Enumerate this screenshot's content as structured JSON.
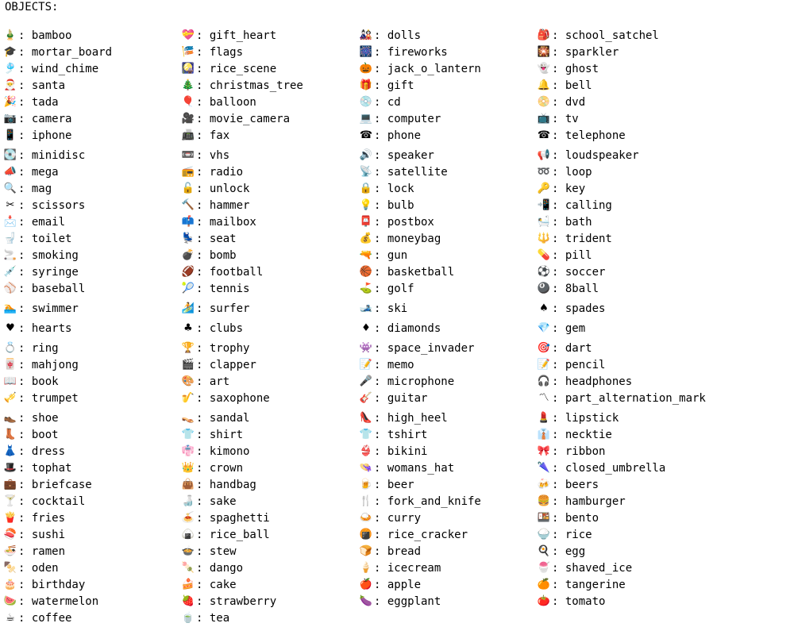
{
  "heading": "OBJECTS:",
  "rows": [
    {
      "tall": false,
      "items": [
        {
          "name": "bamboo",
          "icon": "bamboo-icon",
          "glyph": "🎍"
        },
        {
          "name": "gift_heart",
          "icon": "gift-heart-icon",
          "glyph": "💝"
        },
        {
          "name": "dolls",
          "icon": "dolls-icon",
          "glyph": "🎎"
        },
        {
          "name": "school_satchel",
          "icon": "school-satchel-icon",
          "glyph": "🎒"
        }
      ]
    },
    {
      "tall": false,
      "items": [
        {
          "name": "mortar_board",
          "icon": "mortar-board-icon",
          "glyph": "🎓"
        },
        {
          "name": "flags",
          "icon": "flags-icon",
          "glyph": "🎏"
        },
        {
          "name": "fireworks",
          "icon": "fireworks-icon",
          "glyph": "🎆"
        },
        {
          "name": "sparkler",
          "icon": "sparkler-icon",
          "glyph": "🎇"
        }
      ]
    },
    {
      "tall": false,
      "items": [
        {
          "name": "wind_chime",
          "icon": "wind-chime-icon",
          "glyph": "🎐"
        },
        {
          "name": "rice_scene",
          "icon": "rice-scene-icon",
          "glyph": "🎑"
        },
        {
          "name": "jack_o_lantern",
          "icon": "jack-o-lantern-icon",
          "glyph": "🎃"
        },
        {
          "name": "ghost",
          "icon": "ghost-icon",
          "glyph": "👻"
        }
      ]
    },
    {
      "tall": false,
      "items": [
        {
          "name": "santa",
          "icon": "santa-icon",
          "glyph": "🎅"
        },
        {
          "name": "christmas_tree",
          "icon": "christmas-tree-icon",
          "glyph": "🎄"
        },
        {
          "name": "gift",
          "icon": "gift-icon",
          "glyph": "🎁"
        },
        {
          "name": "bell",
          "icon": "bell-icon",
          "glyph": "🔔"
        }
      ]
    },
    {
      "tall": false,
      "items": [
        {
          "name": "tada",
          "icon": "tada-icon",
          "glyph": "🎉"
        },
        {
          "name": "balloon",
          "icon": "balloon-icon",
          "glyph": "🎈"
        },
        {
          "name": "cd",
          "icon": "cd-icon",
          "glyph": "💿"
        },
        {
          "name": "dvd",
          "icon": "dvd-icon",
          "glyph": "📀"
        }
      ]
    },
    {
      "tall": false,
      "items": [
        {
          "name": "camera",
          "icon": "camera-icon",
          "glyph": "📷"
        },
        {
          "name": "movie_camera",
          "icon": "movie-camera-icon",
          "glyph": "🎥"
        },
        {
          "name": "computer",
          "icon": "computer-icon",
          "glyph": "💻"
        },
        {
          "name": "tv",
          "icon": "tv-icon",
          "glyph": "📺"
        }
      ]
    },
    {
      "tall": true,
      "items": [
        {
          "name": "iphone",
          "icon": "iphone-icon",
          "glyph": "📱"
        },
        {
          "name": "fax",
          "icon": "fax-icon",
          "glyph": "📠"
        },
        {
          "name": "phone",
          "icon": "phone-icon",
          "glyph": "☎"
        },
        {
          "name": "telephone",
          "icon": "telephone-icon",
          "glyph": "☎"
        }
      ]
    },
    {
      "tall": false,
      "items": [
        {
          "name": "minidisc",
          "icon": "minidisc-icon",
          "glyph": "💽"
        },
        {
          "name": "vhs",
          "icon": "vhs-icon",
          "glyph": "📼"
        },
        {
          "name": "speaker",
          "icon": "speaker-icon",
          "glyph": "🔊"
        },
        {
          "name": "loudspeaker",
          "icon": "loudspeaker-icon",
          "glyph": "📢"
        }
      ]
    },
    {
      "tall": false,
      "items": [
        {
          "name": "mega",
          "icon": "mega-icon",
          "glyph": "📣"
        },
        {
          "name": "radio",
          "icon": "radio-icon",
          "glyph": "📻"
        },
        {
          "name": "satellite",
          "icon": "satellite-icon",
          "glyph": "📡"
        },
        {
          "name": "loop",
          "icon": "loop-icon",
          "glyph": "➿"
        }
      ]
    },
    {
      "tall": false,
      "items": [
        {
          "name": "mag",
          "icon": "mag-icon",
          "glyph": "🔍"
        },
        {
          "name": "unlock",
          "icon": "unlock-icon",
          "glyph": "🔓"
        },
        {
          "name": "lock",
          "icon": "lock-icon",
          "glyph": "🔒"
        },
        {
          "name": "key",
          "icon": "key-icon",
          "glyph": "🔑"
        }
      ]
    },
    {
      "tall": false,
      "items": [
        {
          "name": "scissors",
          "icon": "scissors-icon",
          "glyph": "✂"
        },
        {
          "name": "hammer",
          "icon": "hammer-icon",
          "glyph": "🔨"
        },
        {
          "name": "bulb",
          "icon": "bulb-icon",
          "glyph": "💡"
        },
        {
          "name": "calling",
          "icon": "calling-icon",
          "glyph": "📲"
        }
      ]
    },
    {
      "tall": false,
      "items": [
        {
          "name": "email",
          "icon": "email-icon",
          "glyph": "📩"
        },
        {
          "name": "mailbox",
          "icon": "mailbox-icon",
          "glyph": "📫"
        },
        {
          "name": "postbox",
          "icon": "postbox-icon",
          "glyph": "📮"
        },
        {
          "name": "bath",
          "icon": "bath-icon",
          "glyph": "🛀"
        }
      ]
    },
    {
      "tall": false,
      "items": [
        {
          "name": "toilet",
          "icon": "toilet-icon",
          "glyph": "🚽"
        },
        {
          "name": "seat",
          "icon": "seat-icon",
          "glyph": "💺"
        },
        {
          "name": "moneybag",
          "icon": "moneybag-icon",
          "glyph": "💰"
        },
        {
          "name": "trident",
          "icon": "trident-icon",
          "glyph": "🔱"
        }
      ]
    },
    {
      "tall": false,
      "items": [
        {
          "name": "smoking",
          "icon": "smoking-icon",
          "glyph": "🚬"
        },
        {
          "name": "bomb",
          "icon": "bomb-icon",
          "glyph": "💣"
        },
        {
          "name": "gun",
          "icon": "gun-icon",
          "glyph": "🔫"
        },
        {
          "name": "pill",
          "icon": "pill-icon",
          "glyph": "💊"
        }
      ]
    },
    {
      "tall": false,
      "items": [
        {
          "name": "syringe",
          "icon": "syringe-icon",
          "glyph": "💉"
        },
        {
          "name": "football",
          "icon": "football-icon",
          "glyph": "🏈"
        },
        {
          "name": "basketball",
          "icon": "basketball-icon",
          "glyph": "🏀"
        },
        {
          "name": "soccer",
          "icon": "soccer-icon",
          "glyph": "⚽"
        }
      ]
    },
    {
      "tall": true,
      "items": [
        {
          "name": "baseball",
          "icon": "baseball-icon",
          "glyph": "⚾"
        },
        {
          "name": "tennis",
          "icon": "tennis-icon",
          "glyph": "🎾"
        },
        {
          "name": "golf",
          "icon": "golf-icon",
          "glyph": "⛳"
        },
        {
          "name": "8ball",
          "icon": "8ball-icon",
          "glyph": "🎱"
        }
      ]
    },
    {
      "tall": true,
      "items": [
        {
          "name": "swimmer",
          "icon": "swimmer-icon",
          "glyph": "🏊"
        },
        {
          "name": "surfer",
          "icon": "surfer-icon",
          "glyph": "🏄"
        },
        {
          "name": "ski",
          "icon": "ski-icon",
          "glyph": "🎿"
        },
        {
          "name": "spades",
          "icon": "spades-icon",
          "glyph": "♠"
        }
      ]
    },
    {
      "tall": true,
      "items": [
        {
          "name": "hearts",
          "icon": "hearts-icon",
          "glyph": "♥"
        },
        {
          "name": "clubs",
          "icon": "clubs-icon",
          "glyph": "♣"
        },
        {
          "name": "diamonds",
          "icon": "diamonds-icon",
          "glyph": "♦"
        },
        {
          "name": "gem",
          "icon": "gem-icon",
          "glyph": "💎"
        }
      ]
    },
    {
      "tall": false,
      "items": [
        {
          "name": "ring",
          "icon": "ring-icon",
          "glyph": "💍"
        },
        {
          "name": "trophy",
          "icon": "trophy-icon",
          "glyph": "🏆"
        },
        {
          "name": "space_invader",
          "icon": "space-invader-icon",
          "glyph": "👾"
        },
        {
          "name": "dart",
          "icon": "dart-icon",
          "glyph": "🎯"
        }
      ]
    },
    {
      "tall": false,
      "items": [
        {
          "name": "mahjong",
          "icon": "mahjong-icon",
          "glyph": "🀄"
        },
        {
          "name": "clapper",
          "icon": "clapper-icon",
          "glyph": "🎬"
        },
        {
          "name": "memo",
          "icon": "memo-icon",
          "glyph": "📝"
        },
        {
          "name": "pencil",
          "icon": "pencil-icon",
          "glyph": "📝"
        }
      ]
    },
    {
      "tall": false,
      "items": [
        {
          "name": "book",
          "icon": "book-icon",
          "glyph": "📖"
        },
        {
          "name": "art",
          "icon": "art-icon",
          "glyph": "🎨"
        },
        {
          "name": "microphone",
          "icon": "microphone-icon",
          "glyph": "🎤"
        },
        {
          "name": "headphones",
          "icon": "headphones-icon",
          "glyph": "🎧"
        }
      ]
    },
    {
      "tall": true,
      "items": [
        {
          "name": "trumpet",
          "icon": "trumpet-icon",
          "glyph": "🎺"
        },
        {
          "name": "saxophone",
          "icon": "saxophone-icon",
          "glyph": "🎷"
        },
        {
          "name": "guitar",
          "icon": "guitar-icon",
          "glyph": "🎸"
        },
        {
          "name": "part_alternation_mark",
          "icon": "part-alternation-mark-icon",
          "glyph": "〽"
        }
      ]
    },
    {
      "tall": false,
      "items": [
        {
          "name": "shoe",
          "icon": "shoe-icon",
          "glyph": "👞"
        },
        {
          "name": "sandal",
          "icon": "sandal-icon",
          "glyph": "👡"
        },
        {
          "name": "high_heel",
          "icon": "high-heel-icon",
          "glyph": "👠"
        },
        {
          "name": "lipstick",
          "icon": "lipstick-icon",
          "glyph": "💄"
        }
      ]
    },
    {
      "tall": false,
      "items": [
        {
          "name": "boot",
          "icon": "boot-icon",
          "glyph": "👢"
        },
        {
          "name": "shirt",
          "icon": "shirt-icon",
          "glyph": "👕"
        },
        {
          "name": "tshirt",
          "icon": "tshirt-icon",
          "glyph": "👕"
        },
        {
          "name": "necktie",
          "icon": "necktie-icon",
          "glyph": "👔"
        }
      ]
    },
    {
      "tall": false,
      "items": [
        {
          "name": "dress",
          "icon": "dress-icon",
          "glyph": "👗"
        },
        {
          "name": "kimono",
          "icon": "kimono-icon",
          "glyph": "👘"
        },
        {
          "name": "bikini",
          "icon": "bikini-icon",
          "glyph": "👙"
        },
        {
          "name": "ribbon",
          "icon": "ribbon-icon",
          "glyph": "🎀"
        }
      ]
    },
    {
      "tall": false,
      "items": [
        {
          "name": "tophat",
          "icon": "tophat-icon",
          "glyph": "🎩"
        },
        {
          "name": "crown",
          "icon": "crown-icon",
          "glyph": "👑"
        },
        {
          "name": "womans_hat",
          "icon": "womans-hat-icon",
          "glyph": "👒"
        },
        {
          "name": "closed_umbrella",
          "icon": "closed-umbrella-icon",
          "glyph": "🌂"
        }
      ]
    },
    {
      "tall": false,
      "items": [
        {
          "name": "briefcase",
          "icon": "briefcase-icon",
          "glyph": "💼"
        },
        {
          "name": "handbag",
          "icon": "handbag-icon",
          "glyph": "👜"
        },
        {
          "name": "beer",
          "icon": "beer-icon",
          "glyph": "🍺"
        },
        {
          "name": "beers",
          "icon": "beers-icon",
          "glyph": "🍻"
        }
      ]
    },
    {
      "tall": false,
      "items": [
        {
          "name": "cocktail",
          "icon": "cocktail-icon",
          "glyph": "🍸"
        },
        {
          "name": "sake",
          "icon": "sake-icon",
          "glyph": "🍶"
        },
        {
          "name": "fork_and_knife",
          "icon": "fork-and-knife-icon",
          "glyph": "🍴"
        },
        {
          "name": "hamburger",
          "icon": "hamburger-icon",
          "glyph": "🍔"
        }
      ]
    },
    {
      "tall": false,
      "items": [
        {
          "name": "fries",
          "icon": "fries-icon",
          "glyph": "🍟"
        },
        {
          "name": "spaghetti",
          "icon": "spaghetti-icon",
          "glyph": "🍝"
        },
        {
          "name": "curry",
          "icon": "curry-icon",
          "glyph": "🍛"
        },
        {
          "name": "bento",
          "icon": "bento-icon",
          "glyph": "🍱"
        }
      ]
    },
    {
      "tall": false,
      "items": [
        {
          "name": "sushi",
          "icon": "sushi-icon",
          "glyph": "🍣"
        },
        {
          "name": "rice_ball",
          "icon": "rice-ball-icon",
          "glyph": "🍙"
        },
        {
          "name": "rice_cracker",
          "icon": "rice-cracker-icon",
          "glyph": "🍘"
        },
        {
          "name": "rice",
          "icon": "rice-icon",
          "glyph": "🍚"
        }
      ]
    },
    {
      "tall": false,
      "items": [
        {
          "name": "ramen",
          "icon": "ramen-icon",
          "glyph": "🍜"
        },
        {
          "name": "stew",
          "icon": "stew-icon",
          "glyph": "🍲"
        },
        {
          "name": "bread",
          "icon": "bread-icon",
          "glyph": "🍞"
        },
        {
          "name": "egg",
          "icon": "egg-icon",
          "glyph": "🍳"
        }
      ]
    },
    {
      "tall": false,
      "items": [
        {
          "name": "oden",
          "icon": "oden-icon",
          "glyph": "🍢"
        },
        {
          "name": "dango",
          "icon": "dango-icon",
          "glyph": "🍡"
        },
        {
          "name": "icecream",
          "icon": "icecream-icon",
          "glyph": "🍦"
        },
        {
          "name": "shaved_ice",
          "icon": "shaved-ice-icon",
          "glyph": "🍧"
        }
      ]
    },
    {
      "tall": false,
      "items": [
        {
          "name": "birthday",
          "icon": "birthday-icon",
          "glyph": "🎂"
        },
        {
          "name": "cake",
          "icon": "cake-icon",
          "glyph": "🍰"
        },
        {
          "name": "apple",
          "icon": "apple-icon",
          "glyph": "🍎"
        },
        {
          "name": "tangerine",
          "icon": "tangerine-icon",
          "glyph": "🍊"
        }
      ]
    },
    {
      "tall": false,
      "items": [
        {
          "name": "watermelon",
          "icon": "watermelon-icon",
          "glyph": "🍉"
        },
        {
          "name": "strawberry",
          "icon": "strawberry-icon",
          "glyph": "🍓"
        },
        {
          "name": "eggplant",
          "icon": "eggplant-icon",
          "glyph": "🍆"
        },
        {
          "name": "tomato",
          "icon": "tomato-icon",
          "glyph": "🍅"
        }
      ]
    },
    {
      "tall": false,
      "items": [
        {
          "name": "coffee",
          "icon": "coffee-icon",
          "glyph": "☕"
        },
        {
          "name": "tea",
          "icon": "tea-icon",
          "glyph": "🍵"
        }
      ]
    }
  ],
  "separator": ": "
}
